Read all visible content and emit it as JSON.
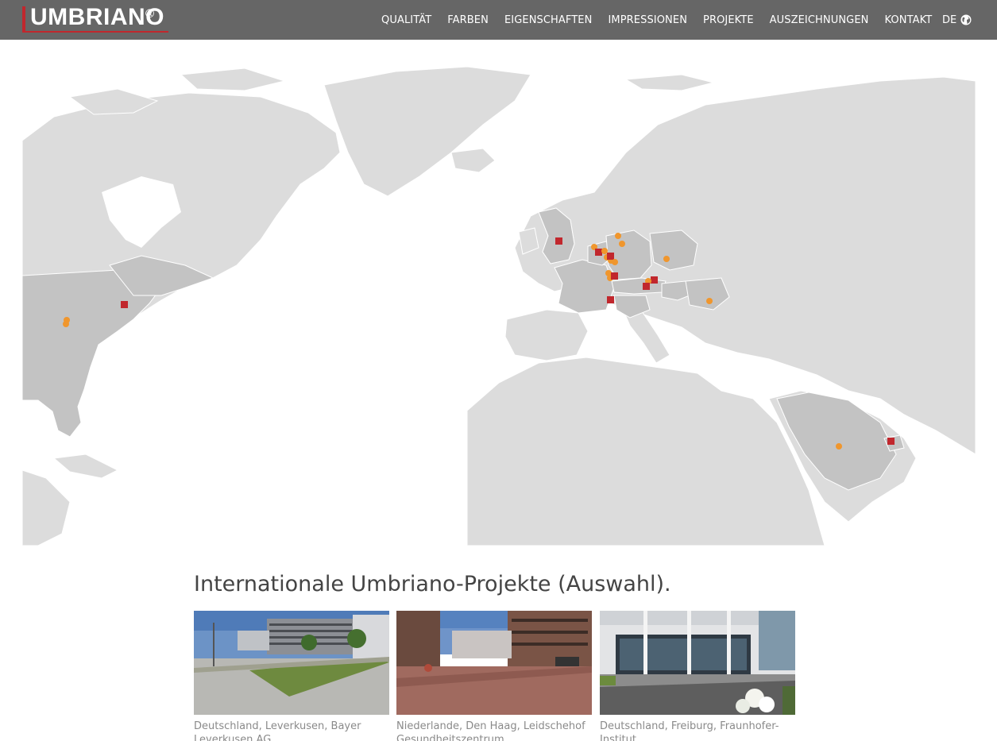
{
  "header": {
    "logo_text": "UMBRIANO",
    "logo_reg": "®",
    "nav": [
      {
        "label": "QUALITÄT"
      },
      {
        "label": "FARBEN"
      },
      {
        "label": "EIGENSCHAFTEN"
      },
      {
        "label": "IMPRESSIONEN"
      },
      {
        "label": "PROJEKTE"
      },
      {
        "label": "AUSZEICHNUNGEN"
      },
      {
        "label": "KONTAKT"
      }
    ],
    "language": "DE",
    "language_icon": "globe-icon"
  },
  "map": {
    "land_color": "#dcdcdc",
    "highlight_color": "#c3c3c3",
    "border_color": "#ffffff",
    "marker_square_color": "#c1272d",
    "marker_dot_color": "#f0962d"
  },
  "projects": {
    "title": "Internationale Umbriano-Projekte (Auswahl).",
    "cards": [
      {
        "caption": "Deutschland, Leverkusen, Bayer Leverkusen AG"
      },
      {
        "caption": "Niederlande, Den Haag, Leidschehof Gesundheitszentrum"
      },
      {
        "caption": "Deutschland, Freiburg, Fraunhofer-Institut"
      }
    ]
  }
}
